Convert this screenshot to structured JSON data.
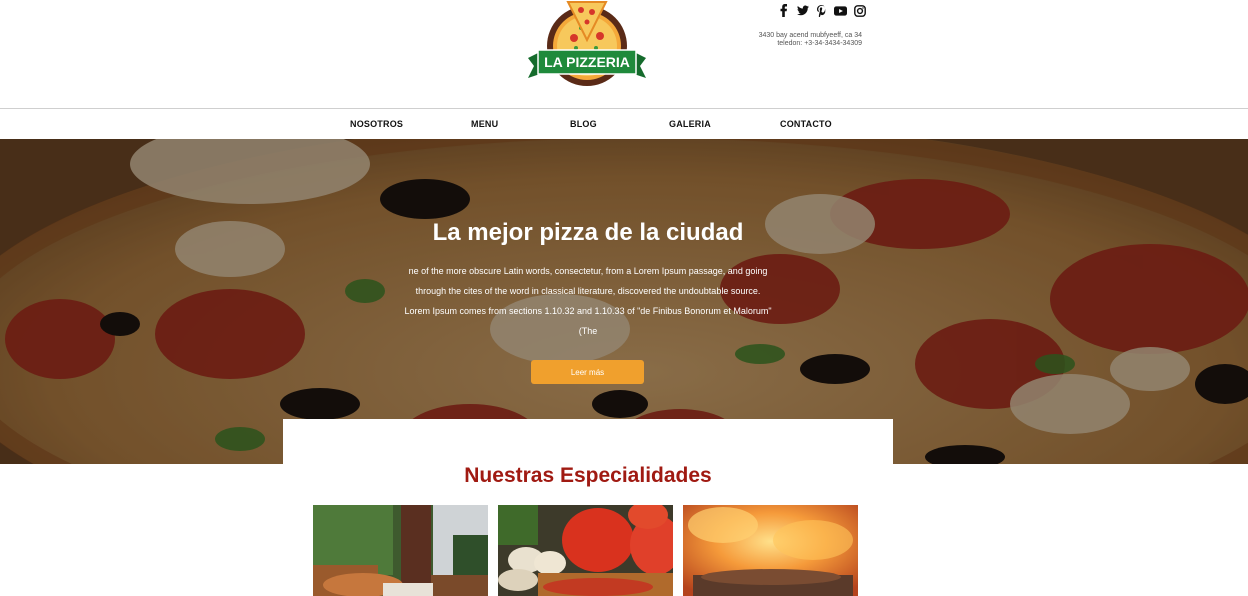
{
  "brand": {
    "name": "LA PIZZERIA",
    "accent": "#f0a02d",
    "banner_green": "#1f8a3b",
    "title_red": "#a01a12"
  },
  "social": [
    "facebook-icon",
    "twitter-icon",
    "pinterest-icon",
    "youtube-icon",
    "instagram-icon"
  ],
  "address": {
    "line1": "3430 bay acend mubfyeeff, ca 34",
    "line2": "teledon: +3-34-3434-34309"
  },
  "nav": {
    "items": [
      "NOSOTROS",
      "MENU",
      "BLOG",
      "GALERIA",
      "CONTACTO"
    ]
  },
  "hero": {
    "title": "La mejor pizza de la ciudad",
    "text": "ne of the more obscure Latin words, consectetur, from a Lorem Ipsum passage, and going through the cites of the word in classical literature, discovered the undoubtable source. Lorem Ipsum comes from sections 1.10.32 and 1.10.33 of \"de Finibus Bonorum et Malorum\" (The",
    "button": "Leer más"
  },
  "specialties": {
    "title": "Nuestras Especialidades",
    "images": [
      "restaurant-terrace-photo",
      "pizza-ingredients-photo",
      "wood-fire-oven-photo"
    ]
  }
}
